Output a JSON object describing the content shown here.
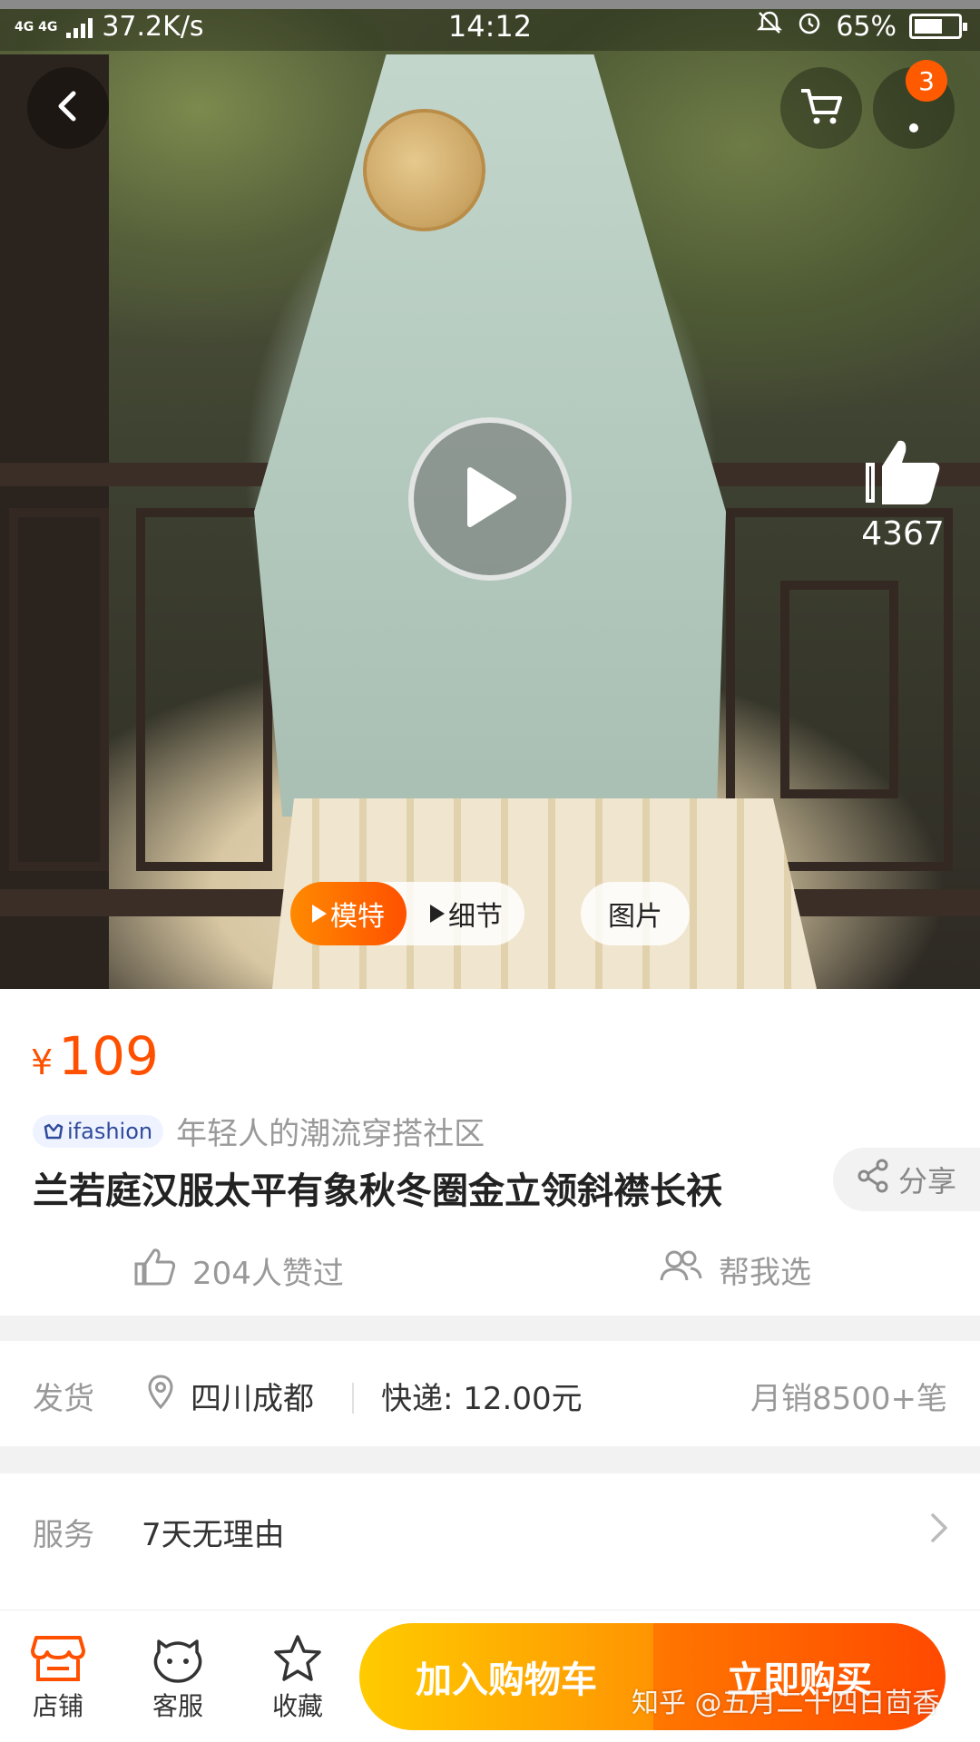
{
  "status_bar": {
    "network": "4G 4G",
    "speed": "37.2K/s",
    "time": "14:12",
    "battery": "65%",
    "battery_level": 0.65
  },
  "hero": {
    "cart_badge_count": "3",
    "like_count": "4367",
    "media_tabs": {
      "model": "模特",
      "detail": "细节",
      "pictures": "图片"
    }
  },
  "product": {
    "currency": "¥",
    "price": "109",
    "brand_logo": "ifashion",
    "brand_tagline": "年轻人的潮流穿搭社区",
    "title": "兰若庭汉服太平有象秋冬圈金立领斜襟长袄",
    "share_label": "分享",
    "liked_text": "204人赞过",
    "help_choose": "帮我选"
  },
  "shipping": {
    "label": "发货",
    "location": "四川成都",
    "fee": "快递: 12.00元",
    "monthly_sales": "月销8500+笔"
  },
  "service": {
    "label": "服务",
    "text": "7天无理由"
  },
  "bottom_bar": {
    "store": "店铺",
    "customer_service": "客服",
    "favorite": "收藏",
    "add_to_cart": "加入购物车",
    "buy_now": "立即购买"
  },
  "watermark": "知乎 @五月二十四日茴香",
  "colors": {
    "accent": "#ff5000",
    "cart_button": "#ffa800",
    "buy_button": "#ff5a00"
  }
}
